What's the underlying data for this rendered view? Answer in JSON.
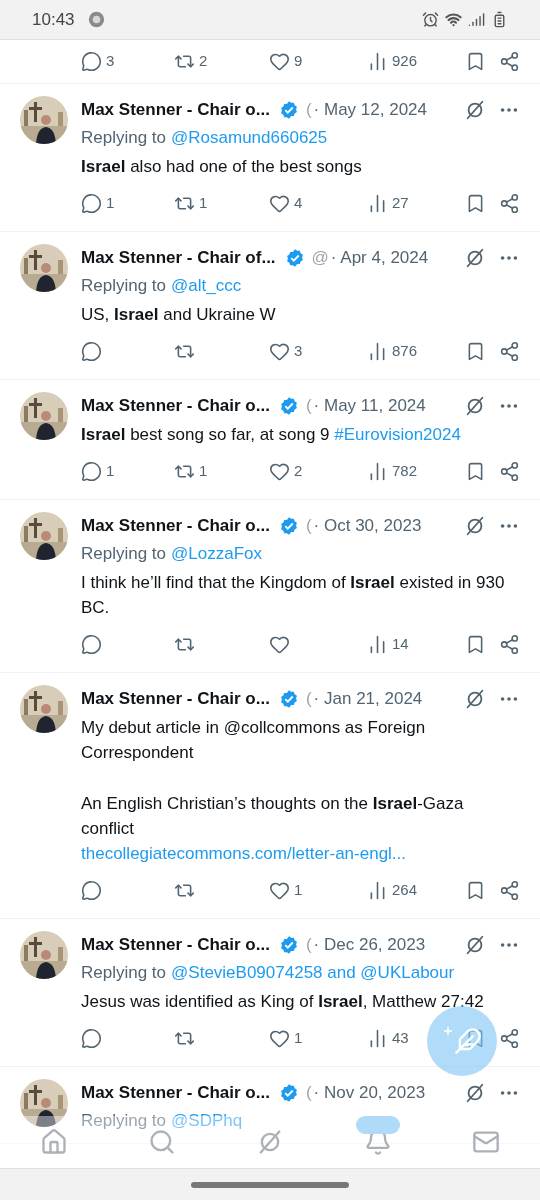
{
  "status_bar": {
    "time": "10:43"
  },
  "tweets": [
    {
      "kind": "actions_only",
      "actions": {
        "replies": "3",
        "reposts": "2",
        "likes": "9",
        "views": "926"
      }
    },
    {
      "kind": "full",
      "name": "Max Stenner - Chair o...",
      "handle": "(",
      "date": "· May 12, 2024",
      "replying_to": {
        "label": "Replying to",
        "mentions": [
          "@Rosamund660625"
        ]
      },
      "body": [
        [
          {
            "kind": "text",
            "text": "**Israel** also had one of the best songs"
          }
        ]
      ],
      "actions": {
        "replies": "1",
        "reposts": "1",
        "likes": "4",
        "views": "27"
      }
    },
    {
      "kind": "full",
      "name": "Max Stenner - Chair of...",
      "handle": "@",
      "date": "· Apr 4, 2024",
      "replying_to": {
        "label": "Replying to",
        "mentions": [
          "@alt_ccc"
        ]
      },
      "body": [
        [
          {
            "kind": "text",
            "text": "US, **Israel** and Ukraine W"
          }
        ]
      ],
      "actions": {
        "likes": "3",
        "views": "876"
      }
    },
    {
      "kind": "full",
      "name": "Max Stenner - Chair o...",
      "handle": "(",
      "date": "· May 11, 2024",
      "body": [
        [
          {
            "kind": "text",
            "text": "**Israel** best song so far, at song 9 "
          },
          {
            "kind": "link",
            "text": "#Eurovision2024"
          }
        ]
      ],
      "actions": {
        "replies": "1",
        "reposts": "1",
        "likes": "2",
        "views": "782"
      }
    },
    {
      "kind": "full",
      "name": "Max Stenner - Chair o...",
      "handle": "(",
      "date": "· Oct 30, 2023",
      "replying_to": {
        "label": "Replying to",
        "mentions": [
          "@LozzaFox"
        ]
      },
      "body": [
        [
          {
            "kind": "text",
            "text": "I think he’ll find that the Kingdom of **Israel** existed in 930 BC."
          }
        ]
      ],
      "actions": {
        "views": "14"
      }
    },
    {
      "kind": "full",
      "name": "Max Stenner - Chair o...",
      "handle": "(",
      "date": "· Jan 21, 2024",
      "body": [
        [
          {
            "kind": "text",
            "text": "My debut article in @collcommons as Foreign Correspondent"
          }
        ],
        [
          {
            "kind": "text",
            "text": "An English Christian’s thoughts on the **Israel**-Gaza conflict"
          },
          {
            "kind": "link",
            "text": "thecollegiatecommons.com/letter-an-engl...",
            "own_line": true
          }
        ]
      ],
      "actions": {
        "likes": "1",
        "views": "264"
      }
    },
    {
      "kind": "full",
      "name": "Max Stenner - Chair o...",
      "handle": "(",
      "date": "· Dec 26, 2023",
      "replying_to": {
        "label": "Replying to",
        "mentions": [
          "@StevieB09074258 and @UKLabour"
        ]
      },
      "body": [
        [
          {
            "kind": "text",
            "text": "Jesus was identified as King of **Israel**, Matthew 27:42"
          }
        ]
      ],
      "actions": {
        "likes": "1",
        "views": "43"
      }
    },
    {
      "kind": "full",
      "name": "Max Stenner - Chair o...",
      "handle": "(",
      "date": "· Nov 20, 2023",
      "replying_to": {
        "label": "Replying to",
        "mentions": [
          "@SDPhq"
        ]
      }
    }
  ]
}
